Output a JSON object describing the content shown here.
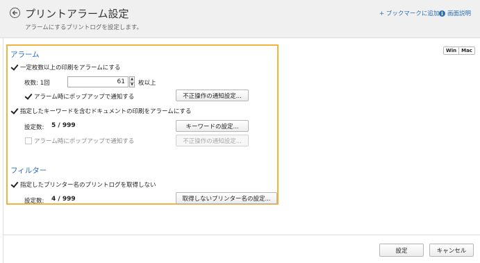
{
  "header": {
    "title": "プリントアラーム設定",
    "subtitle": "アラームにするプリントログを設定します。",
    "bookmark_link": "+ ブックマークに追加",
    "help_link": "画面説明"
  },
  "platform_toggle": {
    "win": "Win",
    "mac": "Mac"
  },
  "alarm_section": {
    "title": "アラーム",
    "copies_check": {
      "label": "一定枚数以上の印刷をアラームにする",
      "checked": true
    },
    "copies_label": "枚数: 1回",
    "copies_value": "61",
    "copies_suffix": "枚以上",
    "popup_check_1": {
      "label": "アラーム時にポップアップで通知する",
      "checked": true
    },
    "notify_button_1": "不正操作の通知設定...",
    "keyword_check": {
      "label": "指定したキーワードを含むドキュメントの印刷をアラームにする",
      "checked": true
    },
    "keyword_count_label": "設定数:",
    "keyword_count_value": "5 / 999",
    "keyword_button": "キーワードの設定...",
    "popup_check_2": {
      "label": "アラーム時にポップアップで通知する",
      "checked": false
    },
    "notify_button_2": "不正操作の通知設定..."
  },
  "filter_section": {
    "title": "フィルター",
    "printer_check": {
      "label": "指定したプリンター名のプリントログを取得しない",
      "checked": true
    },
    "printer_count_label": "設定数:",
    "printer_count_value": "4 / 999",
    "printer_button": "取得しないプリンター名の設定..."
  },
  "footer": {
    "save_button": "設定",
    "cancel_button": "キャンセル"
  },
  "colors": {
    "accent": "#2a6fb8",
    "highlight": "#f2b23c"
  }
}
